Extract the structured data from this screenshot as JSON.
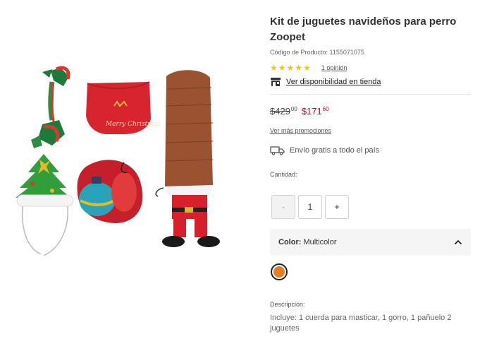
{
  "product": {
    "title": "Kit de juguetes navideños para perro Zoopet",
    "code_label": "Código de Producto: 1155071075",
    "rating_stars": 5,
    "reviews_link": "1 opinión",
    "store_availability": "Ver disponibilidad en tienda"
  },
  "price": {
    "old_main": "$429",
    "old_cents": "00",
    "new_main": "$171",
    "new_cents": "60",
    "promos_link": "Ver más promociones"
  },
  "shipping": {
    "text": "Envío gratis a todo el país"
  },
  "quantity": {
    "label": "Cantidad:",
    "value": "1",
    "minus": "-",
    "plus": "+"
  },
  "color": {
    "label": "Color:",
    "value": "Multicolor",
    "swatch_color": "#e67e22"
  },
  "description": {
    "label": "Descripción:",
    "text": "Incluye: 1 cuerda para masticar, 1 gorro, 1 pañuelo 2 juguetes"
  },
  "image": {
    "bandana_text": "Merry Christmas"
  },
  "icons": [
    "star-icon",
    "store-icon",
    "truck-icon",
    "chevron-up-icon"
  ],
  "colors": {
    "sale_red": "#d0021b",
    "star_yellow": "#f2c311",
    "panel_gray": "#f5f5f5"
  }
}
